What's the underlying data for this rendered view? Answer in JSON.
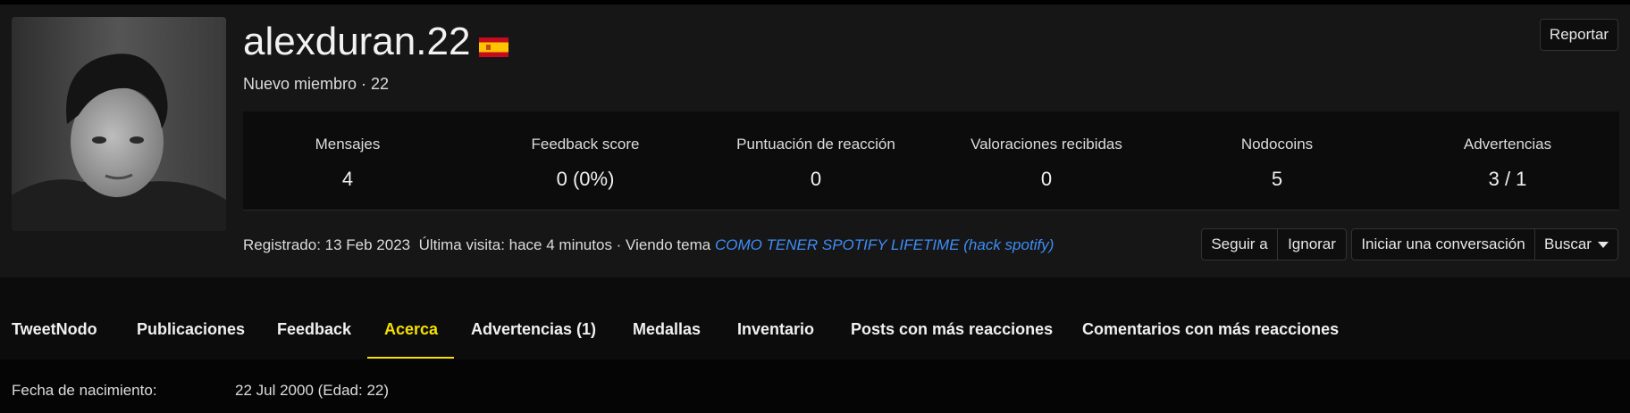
{
  "profile": {
    "username": "alexduran.22",
    "country_flag": "spain-flag",
    "subtitle": "Nuevo miembro · 22",
    "report_label": "Reportar"
  },
  "stats": [
    {
      "label": "Mensajes",
      "value": "4"
    },
    {
      "label": "Feedback score",
      "value": "0 (0%)"
    },
    {
      "label": "Puntuación de reacción",
      "value": "0"
    },
    {
      "label": "Valoraciones recibidas",
      "value": "0"
    },
    {
      "label": "Nodocoins",
      "value": "5"
    },
    {
      "label": "Advertencias",
      "value": "3 / 1"
    }
  ],
  "meta": {
    "registered": "Registrado: 13 Feb 2023",
    "last_visit": "Última visita: hace 4 minutos · Viendo tema",
    "topic_link": "COMO TENER SPOTIFY LIFETIME (hack spotify)"
  },
  "actions": {
    "follow": "Seguir a",
    "ignore": "Ignorar",
    "start_conversation": "Iniciar una conversación",
    "search": "Buscar"
  },
  "tabs": [
    {
      "label": "TweetNodo"
    },
    {
      "label": "Publicaciones"
    },
    {
      "label": "Feedback"
    },
    {
      "label": "Acerca",
      "active": true
    },
    {
      "label": "Advertencias (1)"
    },
    {
      "label": "Medallas"
    },
    {
      "label": "Inventario"
    },
    {
      "label": "Posts con más reacciones"
    },
    {
      "label": "Comentarios con más reacciones"
    }
  ],
  "about": {
    "birth_label": "Fecha de nacimiento:",
    "birth_value": "22 Jul 2000 (Edad: 22)"
  },
  "colors": {
    "accent": "#f5e000",
    "link": "#3e8ef7",
    "panel": "#161616",
    "background": "#0c0c0c"
  }
}
